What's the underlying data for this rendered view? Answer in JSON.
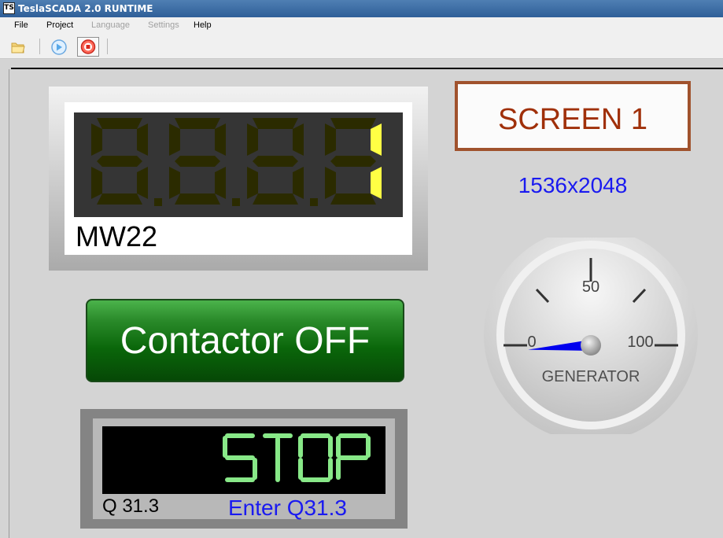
{
  "window": {
    "title": "TeslaSCADA 2.0 RUNTIME",
    "icon_text": "TS"
  },
  "menu": {
    "file": "File",
    "project": "Project",
    "language": "Language",
    "settings": "Settings",
    "help": "Help"
  },
  "toolbar": {
    "open_icon": "folder-icon",
    "run_icon": "play-icon",
    "stop_icon": "stop-icon"
  },
  "digital_display": {
    "label": "MW22",
    "value": "1",
    "active_color": "#ffff44",
    "inactive_color": "#2b2b00"
  },
  "screen": {
    "title": "SCREEN 1",
    "resolution": "1536x2048"
  },
  "contactor": {
    "label": "Contactor OFF"
  },
  "gauge": {
    "label": "GENERATOR",
    "tick_min": "0",
    "tick_mid": "50",
    "tick_max": "100",
    "value": 0,
    "needle_color": "#0000ee"
  },
  "status": {
    "display_text": "STOP",
    "text_color": "#88e888",
    "address": "Q 31.3",
    "action": "Enter Q31.3"
  }
}
